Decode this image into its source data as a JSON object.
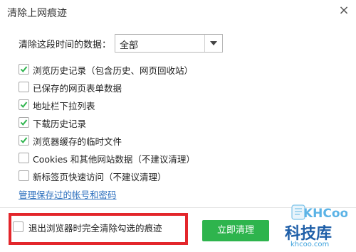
{
  "window": {
    "title": "清除上网痕迹",
    "close_icon": "×"
  },
  "range": {
    "label": "清除这段时间的数据：",
    "selected": "全部"
  },
  "options": [
    {
      "label": "浏览历史记录（包含历史、网页回收站）",
      "checked": true
    },
    {
      "label": "已保存的网页表单数据",
      "checked": false
    },
    {
      "label": "地址栏下拉列表",
      "checked": true
    },
    {
      "label": "下载历史记录",
      "checked": true
    },
    {
      "label": "浏览器缓存的临时文件",
      "checked": true
    },
    {
      "label": "Cookies 和其他网站数据（不建议清理）",
      "checked": false
    },
    {
      "label": "新标签页快速访问（不建议清理）",
      "checked": false
    }
  ],
  "manage_link": "管理保存过的帐号和密码",
  "footer": {
    "exit_clear_label": "退出浏览器时完全清除勾选的痕迹",
    "exit_clear_checked": false,
    "clear_button": "立即清理"
  },
  "watermark": {
    "logo": "KHCoo",
    "text": "科技库",
    "domain": "khcoo.com"
  },
  "colors": {
    "check": "#2eb44d",
    "button": "#2eb44d",
    "highlight": "#e3262b",
    "link": "#2a6ebd"
  }
}
